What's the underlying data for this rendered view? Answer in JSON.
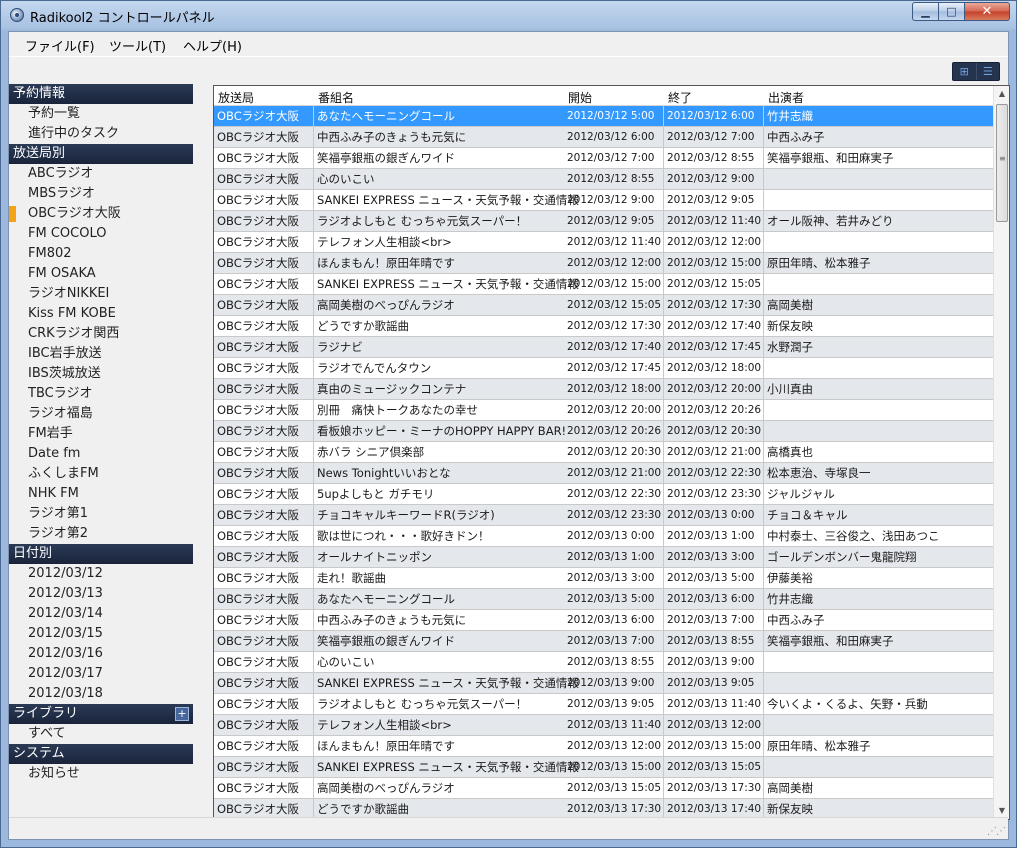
{
  "window": {
    "title": "Radikool2 コントロールパネル"
  },
  "window_buttons": {
    "minimize": "▁",
    "maximize": "□",
    "close": "✕"
  },
  "menu": [
    "ファイル(F)",
    "ツール(T)",
    "ヘルプ(H)"
  ],
  "view_toggle": {
    "grid_icon": "⊞",
    "list_icon": "☰"
  },
  "sidebar": {
    "sections": [
      {
        "header": "予約情報",
        "items": [
          "予約一覧",
          "進行中のタスク"
        ]
      },
      {
        "header": "放送局別",
        "items": [
          "ABCラジオ",
          "MBSラジオ",
          "OBCラジオ大阪",
          "FM COCOLO",
          "FM802",
          "FM OSAKA",
          "ラジオNIKKEI",
          "Kiss FM KOBE",
          "CRKラジオ関西",
          "IBC岩手放送",
          "IBS茨城放送",
          "TBCラジオ",
          "ラジオ福島",
          "FM岩手",
          "Date fm",
          "ふくしまFM",
          "NHK FM",
          "ラジオ第1",
          "ラジオ第2"
        ]
      },
      {
        "header": "日付別",
        "items": [
          "2012/03/12",
          "2012/03/13",
          "2012/03/14",
          "2012/03/15",
          "2012/03/16",
          "2012/03/17",
          "2012/03/18"
        ]
      },
      {
        "header": "ライブラリ",
        "plus": "+",
        "items": [
          "すべて"
        ]
      },
      {
        "header": "システム",
        "items": [
          "お知らせ"
        ]
      }
    ],
    "selected_item": "OBCラジオ大阪"
  },
  "table": {
    "columns": [
      "放送局",
      "番組名",
      "開始",
      "終了",
      "出演者"
    ],
    "rows": [
      [
        "OBCラジオ大阪",
        "あなたへモーニングコール",
        "2012/03/12 5:00",
        "2012/03/12 6:00",
        "竹井志織"
      ],
      [
        "OBCラジオ大阪",
        "中西ふみ子のきょうも元気に",
        "2012/03/12 6:00",
        "2012/03/12 7:00",
        "中西ふみ子"
      ],
      [
        "OBCラジオ大阪",
        "笑福亭銀瓶の銀ぎんワイド",
        "2012/03/12 7:00",
        "2012/03/12 8:55",
        "笑福亭銀瓶、和田麻実子"
      ],
      [
        "OBCラジオ大阪",
        "心のいこい",
        "2012/03/12 8:55",
        "2012/03/12 9:00",
        ""
      ],
      [
        "OBCラジオ大阪",
        "SANKEI EXPRESS ニュース・天気予報・交通情報",
        "2012/03/12 9:00",
        "2012/03/12 9:05",
        ""
      ],
      [
        "OBCラジオ大阪",
        "ラジオよしもと むっちゃ元気スーパー！",
        "2012/03/12 9:05",
        "2012/03/12 11:40",
        "オール阪神、若井みどり"
      ],
      [
        "OBCラジオ大阪",
        "テレフォン人生相談<br>",
        "2012/03/12 11:40",
        "2012/03/12 12:00",
        ""
      ],
      [
        "OBCラジオ大阪",
        "ほんまもん！原田年晴です",
        "2012/03/12 12:00",
        "2012/03/12 15:00",
        "原田年晴、松本雅子"
      ],
      [
        "OBCラジオ大阪",
        "SANKEI EXPRESS ニュース・天気予報・交通情報",
        "2012/03/12 15:00",
        "2012/03/12 15:05",
        ""
      ],
      [
        "OBCラジオ大阪",
        "高岡美樹のべっぴんラジオ",
        "2012/03/12 15:05",
        "2012/03/12 17:30",
        "高岡美樹"
      ],
      [
        "OBCラジオ大阪",
        "どうですか歌謡曲",
        "2012/03/12 17:30",
        "2012/03/12 17:40",
        "新保友映"
      ],
      [
        "OBCラジオ大阪",
        "ラジナビ",
        "2012/03/12 17:40",
        "2012/03/12 17:45",
        "水野潤子"
      ],
      [
        "OBCラジオ大阪",
        "ラジオでんでんタウン",
        "2012/03/12 17:45",
        "2012/03/12 18:00",
        ""
      ],
      [
        "OBCラジオ大阪",
        "真由のミュージックコンテナ",
        "2012/03/12 18:00",
        "2012/03/12 20:00",
        "小川真由"
      ],
      [
        "OBCラジオ大阪",
        "別冊　痛快トークあなたの幸せ",
        "2012/03/12 20:00",
        "2012/03/12 20:26",
        ""
      ],
      [
        "OBCラジオ大阪",
        "看板娘ホッピー・ミーナのHOPPY HAPPY BAR!",
        "2012/03/12 20:26",
        "2012/03/12 20:30",
        ""
      ],
      [
        "OBCラジオ大阪",
        "赤バラ シニア倶楽部",
        "2012/03/12 20:30",
        "2012/03/12 21:00",
        "高橋真也"
      ],
      [
        "OBCラジオ大阪",
        "News Tonightいいおとな",
        "2012/03/12 21:00",
        "2012/03/12 22:30",
        "松本恵治、寺塚良一"
      ],
      [
        "OBCラジオ大阪",
        "5upよしもと ガチモリ",
        "2012/03/12 22:30",
        "2012/03/12 23:30",
        "ジャルジャル"
      ],
      [
        "OBCラジオ大阪",
        "チョコキャルキーワードR(ラジオ)",
        "2012/03/12 23:30",
        "2012/03/13 0:00",
        "チョコ＆キャル"
      ],
      [
        "OBCラジオ大阪",
        "歌は世につれ・・・歌好きドン！",
        "2012/03/13 0:00",
        "2012/03/13 1:00",
        "中村泰士、三谷俊之、浅田あつこ"
      ],
      [
        "OBCラジオ大阪",
        "オールナイトニッポン",
        "2012/03/13 1:00",
        "2012/03/13 3:00",
        "ゴールデンボンバー鬼龍院翔"
      ],
      [
        "OBCラジオ大阪",
        "走れ！歌謡曲",
        "2012/03/13 3:00",
        "2012/03/13 5:00",
        "伊藤美裕"
      ],
      [
        "OBCラジオ大阪",
        "あなたへモーニングコール",
        "2012/03/13 5:00",
        "2012/03/13 6:00",
        "竹井志織"
      ],
      [
        "OBCラジオ大阪",
        "中西ふみ子のきょうも元気に",
        "2012/03/13 6:00",
        "2012/03/13 7:00",
        "中西ふみ子"
      ],
      [
        "OBCラジオ大阪",
        "笑福亭銀瓶の銀ぎんワイド",
        "2012/03/13 7:00",
        "2012/03/13 8:55",
        "笑福亭銀瓶、和田麻実子"
      ],
      [
        "OBCラジオ大阪",
        "心のいこい",
        "2012/03/13 8:55",
        "2012/03/13 9:00",
        ""
      ],
      [
        "OBCラジオ大阪",
        "SANKEI EXPRESS ニュース・天気予報・交通情報",
        "2012/03/13 9:00",
        "2012/03/13 9:05",
        ""
      ],
      [
        "OBCラジオ大阪",
        "ラジオよしもと むっちゃ元気スーパー！",
        "2012/03/13 9:05",
        "2012/03/13 11:40",
        "今いくよ・くるよ、矢野・兵動"
      ],
      [
        "OBCラジオ大阪",
        "テレフォン人生相談<br>",
        "2012/03/13 11:40",
        "2012/03/13 12:00",
        ""
      ],
      [
        "OBCラジオ大阪",
        "ほんまもん！原田年晴です",
        "2012/03/13 12:00",
        "2012/03/13 15:00",
        "原田年晴、松本雅子"
      ],
      [
        "OBCラジオ大阪",
        "SANKEI EXPRESS ニュース・天気予報・交通情報",
        "2012/03/13 15:00",
        "2012/03/13 15:05",
        ""
      ],
      [
        "OBCラジオ大阪",
        "高岡美樹のべっぴんラジオ",
        "2012/03/13 15:05",
        "2012/03/13 17:30",
        "高岡美樹"
      ],
      [
        "OBCラジオ大阪",
        "どうですか歌謡曲",
        "2012/03/13 17:30",
        "2012/03/13 17:40",
        "新保友映"
      ]
    ],
    "selected_row": 0
  },
  "scrollbar": {
    "up": "▲",
    "down": "▼",
    "grip": "≡",
    "position": 0.0
  },
  "statusbar": {
    "grip": "⋰⋰"
  },
  "colors": {
    "selection": "#3399ff",
    "accent_marker": "#f3a319",
    "section_header": "#1f2b44"
  }
}
